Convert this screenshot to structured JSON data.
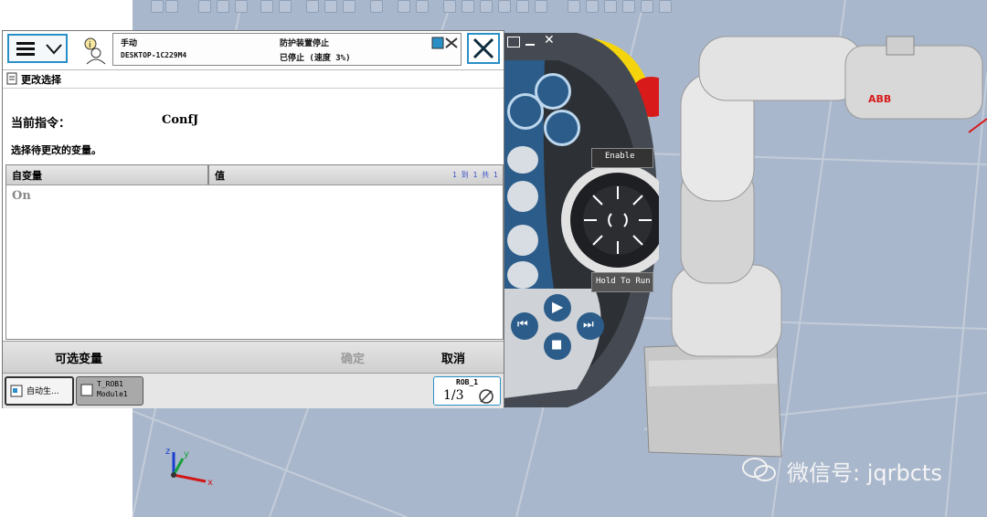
{
  "window": {
    "status": {
      "mode": "手动",
      "controller": "DESKTOP-1C229M4",
      "state": "防护装置停止",
      "run_state": "已停止 (速度 3%)"
    },
    "title": "更改选择"
  },
  "content": {
    "current_instruction_label": "当前指令：",
    "current_instruction_value": "ConfJ",
    "prompt": "选择待更改的变量。",
    "table": {
      "columns": [
        "自变量",
        "值"
      ],
      "pagination": "1 到 1 共 1",
      "rows": [
        {
          "arg": "On",
          "value": ""
        }
      ]
    }
  },
  "actions": {
    "optional_vars": "可选变量",
    "ok": "确定",
    "cancel": "取消"
  },
  "taskbar": {
    "task1": "自动生...",
    "task2_line1": "T_ROB1",
    "task2_line2": "Module1",
    "rob_label": "ROB_1",
    "rob_fraction": "1/3"
  },
  "pendant": {
    "enable_label": "Enable",
    "hold_label": "Hold To Run"
  },
  "robot": {
    "brand": "ABB"
  },
  "watermark": {
    "text": "微信号: jqrbcts"
  },
  "colors": {
    "accent": "#2a8fc6",
    "pendant_blue": "#2c5d8a",
    "emergency_red": "#d81a1a",
    "emergency_yellow": "#f4d40c",
    "viewport_bg": "#a9b7cc"
  }
}
